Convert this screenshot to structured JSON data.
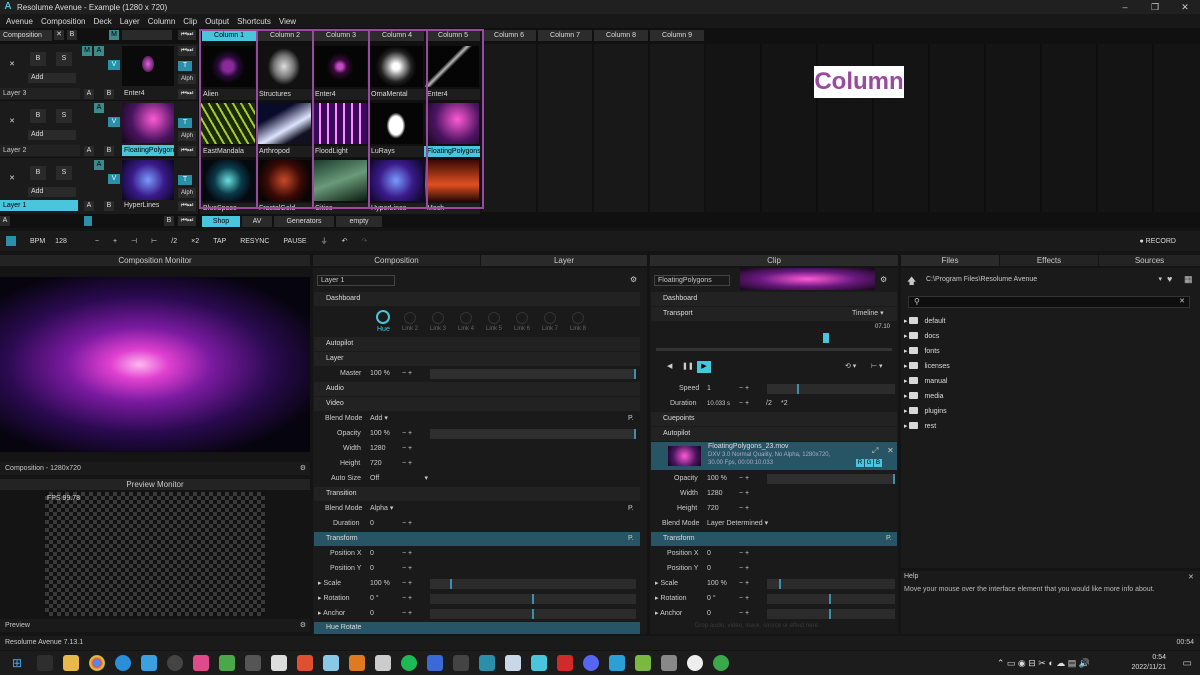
{
  "window": {
    "title": "Resolume Avenue - Example (1280 x 720)"
  },
  "menu": [
    "Avenue",
    "Composition",
    "Deck",
    "Layer",
    "Column",
    "Clip",
    "Output",
    "Shortcuts",
    "View"
  ],
  "deck": {
    "composition_label": "Composition",
    "column_headers": [
      "Column 1",
      "Column 2",
      "Column 3",
      "Column 4",
      "Column 5",
      "Column 6",
      "Column 7",
      "Column 8",
      "Column 9"
    ],
    "layers": [
      {
        "name": "Layer 3",
        "add": "Add",
        "active_clip": "Enter4",
        "clips": [
          "Alien",
          "Structures",
          "Enter4",
          "OrnaMental",
          "Enter4"
        ]
      },
      {
        "name": "Layer 2",
        "add": "Add",
        "active_clip": "FloatingPolygons",
        "clips": [
          "EastMandala",
          "Arthropod",
          "FloodLight",
          "LuRays",
          "FloatingPolygons"
        ]
      },
      {
        "name": "Layer 1",
        "add": "Add",
        "active_clip": "HyperLines",
        "clips": [
          "BlueSpace",
          "FractalGold",
          "Cities",
          "HyperLines",
          "Mech"
        ]
      }
    ],
    "deck_tabs": [
      "Shop",
      "AV",
      "Generators",
      "empty"
    ],
    "column_badge": "Column"
  },
  "toolbar": {
    "bpm_label": "BPM",
    "bpm_value": "128",
    "minus": "−",
    "plus": "+",
    "half": "/2",
    "double": "×2",
    "tap": "TAP",
    "resync": "RESYNC",
    "pause": "PAUSE",
    "record": "RECORD"
  },
  "monitor": {
    "title": "Composition Monitor",
    "comp_label": "Composition - 1280x720",
    "preview_title": "Preview Monitor",
    "fps": "FPS 99.78",
    "preview_label": "Preview"
  },
  "layer_panel": {
    "tab_composition": "Composition",
    "tab_layer": "Layer",
    "layer_name": "Layer 1",
    "dashboard": "Dashboard",
    "dials": [
      "Hue",
      "Link 2",
      "Link 3",
      "Link 4",
      "Link 5",
      "Link 6",
      "Link 7",
      "Link 8"
    ],
    "autopilot": "Autopilot",
    "layer": "Layer",
    "master_label": "Master",
    "master_value": "100 %",
    "audio": "Audio",
    "video": "Video",
    "blend_label": "Blend Mode",
    "blend_value": "Add",
    "opacity_label": "Opacity",
    "opacity_value": "100 %",
    "width_label": "Width",
    "width_value": "1280",
    "height_label": "Height",
    "height_value": "720",
    "autosize_label": "Auto Size",
    "autosize_value": "Off",
    "transition": "Transition",
    "tblend_label": "Blend Mode",
    "tblend_value": "Alpha",
    "duration_label": "Duration",
    "duration_value": "0",
    "transform": "Transform",
    "posx_label": "Position X",
    "posx_value": "0",
    "posy_label": "Position Y",
    "posy_value": "0",
    "scale_label": "Scale",
    "scale_value": "100 %",
    "rotation_label": "Rotation",
    "rotation_value": "0 °",
    "anchor_label": "Anchor",
    "anchor_value": "0",
    "hue_rotate": "Hue Rotate"
  },
  "clip_panel": {
    "title": "Clip",
    "clip_name": "FloatingPolygons",
    "dashboard": "Dashboard",
    "transport": "Transport",
    "timeline": "Timeline",
    "time": "07.10",
    "speed_label": "Speed",
    "speed_value": "1",
    "duration_label": "Duration",
    "duration_value": "10.033 s",
    "half": "/2",
    "double": "*2",
    "cuepoints": "Cuepoints",
    "autopilot": "Autopilot",
    "file_name": "FloatingPolygons_23.mov",
    "file_info1": "DXV 3.0 Normal Quality, No Alpha, 1280x720,",
    "file_info2": "30.00 Fps, 00:00:10.033",
    "rgb": [
      "R",
      "G",
      "B"
    ],
    "opacity_label": "Opacity",
    "opacity_value": "100 %",
    "width_label": "Width",
    "width_value": "1280",
    "height_label": "Height",
    "height_value": "720",
    "blend_label": "Blend Mode",
    "blend_value": "Layer Determined",
    "transform": "Transform",
    "posx_label": "Position X",
    "posx_value": "0",
    "posy_label": "Position Y",
    "posy_value": "0",
    "scale_label": "Scale",
    "scale_value": "100 %",
    "rotation_label": "Rotation",
    "rotation_value": "0 °",
    "anchor_label": "Anchor",
    "anchor_value": "0",
    "drop_hint": "Drop audio, video, mask, source or effect here"
  },
  "files_panel": {
    "tabs": [
      "Files",
      "Effects",
      "Sources"
    ],
    "path": "C:\\Program Files\\Resolume Avenue",
    "folders": [
      "default",
      "docs",
      "fonts",
      "licenses",
      "manual",
      "media",
      "plugins",
      "rest"
    ],
    "help_title": "Help",
    "help_text": "Move your mouse over the interface element that you would like more info about."
  },
  "status": {
    "version": "Resolume Avenue 7.13.1",
    "time": "00:54"
  },
  "taskbar": {
    "time": "0:54",
    "date": "2022/11/21"
  }
}
